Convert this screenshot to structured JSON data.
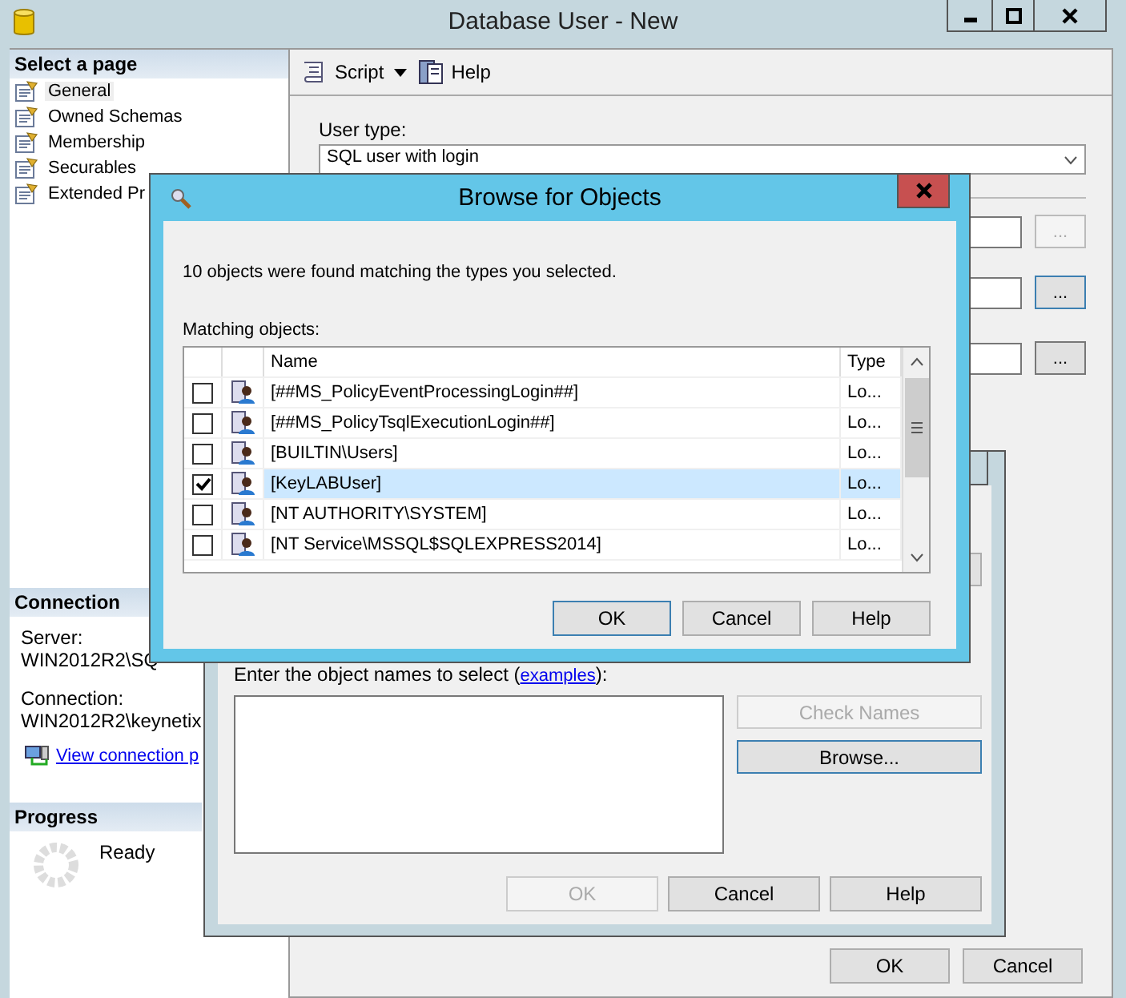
{
  "main_window": {
    "title": "Database User - New"
  },
  "sidebar": {
    "header": "Select a page",
    "items": [
      {
        "label": "General",
        "selected": true
      },
      {
        "label": "Owned Schemas",
        "selected": false
      },
      {
        "label": "Membership",
        "selected": false
      },
      {
        "label": "Securables",
        "selected": false
      },
      {
        "label": "Extended Pr",
        "selected": false
      }
    ]
  },
  "connection": {
    "header": "Connection",
    "server_label": "Server:",
    "server": "WIN2012R2\\SQ",
    "connection_label": "Connection:",
    "connection": "WIN2012R2\\keynetix",
    "link": "View connection p"
  },
  "progress": {
    "header": "Progress",
    "status": "Ready"
  },
  "toolbar": {
    "items": [
      {
        "label": "Script",
        "kind": "script"
      },
      {
        "label": "Help",
        "kind": "help"
      }
    ]
  },
  "form": {
    "user_type_label": "User type:",
    "user_type_value": "SQL user with login",
    "browse_buttons": [
      {
        "label": "...",
        "disabled": true,
        "focused": false
      },
      {
        "label": "...",
        "disabled": false,
        "focused": true
      },
      {
        "label": "...",
        "disabled": false,
        "focused": false
      }
    ]
  },
  "main_buttons": [
    "OK",
    "Cancel"
  ],
  "select_dialog": {
    "prompt_before": "Enter the object names to select (",
    "link": "examples",
    "prompt_after": "):",
    "side_buttons": [
      {
        "label": "Check Names",
        "disabled": true,
        "focused": false
      },
      {
        "label": "Browse...",
        "disabled": false,
        "focused": true
      }
    ],
    "buttons": [
      {
        "label": "OK",
        "disabled": true
      },
      {
        "label": "Cancel",
        "disabled": false
      },
      {
        "label": "Help",
        "disabled": false
      }
    ]
  },
  "browse_dialog": {
    "title": "Browse for Objects",
    "message": "10 objects were found matching the types you selected.",
    "list_label": "Matching objects:",
    "columns": [
      "Name",
      "Type"
    ],
    "rows": [
      {
        "name": "[##MS_PolicyEventProcessingLogin##]",
        "type": "Lo...",
        "checked": false,
        "selected": false
      },
      {
        "name": "[##MS_PolicyTsqlExecutionLogin##]",
        "type": "Lo...",
        "checked": false,
        "selected": false
      },
      {
        "name": "[BUILTIN\\Users]",
        "type": "Lo...",
        "checked": false,
        "selected": false
      },
      {
        "name": "[KeyLABUser]",
        "type": "Lo...",
        "checked": true,
        "selected": true
      },
      {
        "name": "[NT AUTHORITY\\SYSTEM]",
        "type": "Lo...",
        "checked": false,
        "selected": false
      },
      {
        "name": "[NT Service\\MSSQL$SQLEXPRESS2014]",
        "type": "Lo...",
        "checked": false,
        "selected": false
      }
    ],
    "buttons": [
      "OK",
      "Cancel",
      "Help"
    ]
  }
}
